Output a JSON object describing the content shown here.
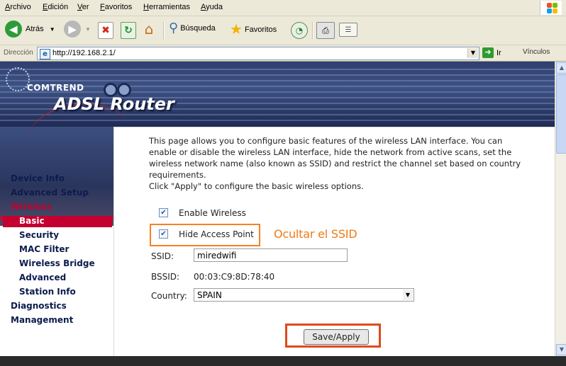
{
  "menu": {
    "items": [
      "Archivo",
      "Edición",
      "Ver",
      "Favoritos",
      "Herramientas",
      "Ayuda"
    ]
  },
  "toolbar": {
    "back_label": "Atrás",
    "search_label": "Búsqueda",
    "favorites_label": "Favoritos"
  },
  "address": {
    "label": "Dirección",
    "url": "http://192.168.2.1/",
    "go_label": "Ir",
    "links_label": "Vínculos"
  },
  "banner": {
    "brand": "COMTREND",
    "title": "ADSL Router"
  },
  "nav": {
    "items": [
      {
        "label": "Device Info"
      },
      {
        "label": "Advanced Setup"
      },
      {
        "label": "Wireless"
      },
      {
        "label": "Basic"
      },
      {
        "label": "Security"
      },
      {
        "label": "MAC Filter"
      },
      {
        "label": "Wireless Bridge"
      },
      {
        "label": "Advanced"
      },
      {
        "label": "Station Info"
      },
      {
        "label": "Diagnostics"
      },
      {
        "label": "Management"
      }
    ]
  },
  "main": {
    "description": "This page allows you to configure basic features of the wireless LAN interface. You can enable or disable the wireless LAN interface, hide the network from active scans, set the wireless network name (also known as SSID) and restrict the channel set based on country requirements.",
    "apply_hint": "Click \"Apply\" to configure the basic wireless options.",
    "enable_wireless_label": "Enable Wireless",
    "enable_wireless_checked": true,
    "hide_ap_label": "Hide Access Point",
    "hide_ap_checked": true,
    "annotation": "Ocultar el SSID",
    "ssid_label": "SSID:",
    "ssid_value": "miredwifi",
    "bssid_label": "BSSID:",
    "bssid_value": "00:03:C9:8D:78:40",
    "country_label": "Country:",
    "country_value": "SPAIN",
    "save_button": "Save/Apply"
  },
  "colors": {
    "accent_red": "#c3002f",
    "annotation_orange": "#f58220"
  }
}
